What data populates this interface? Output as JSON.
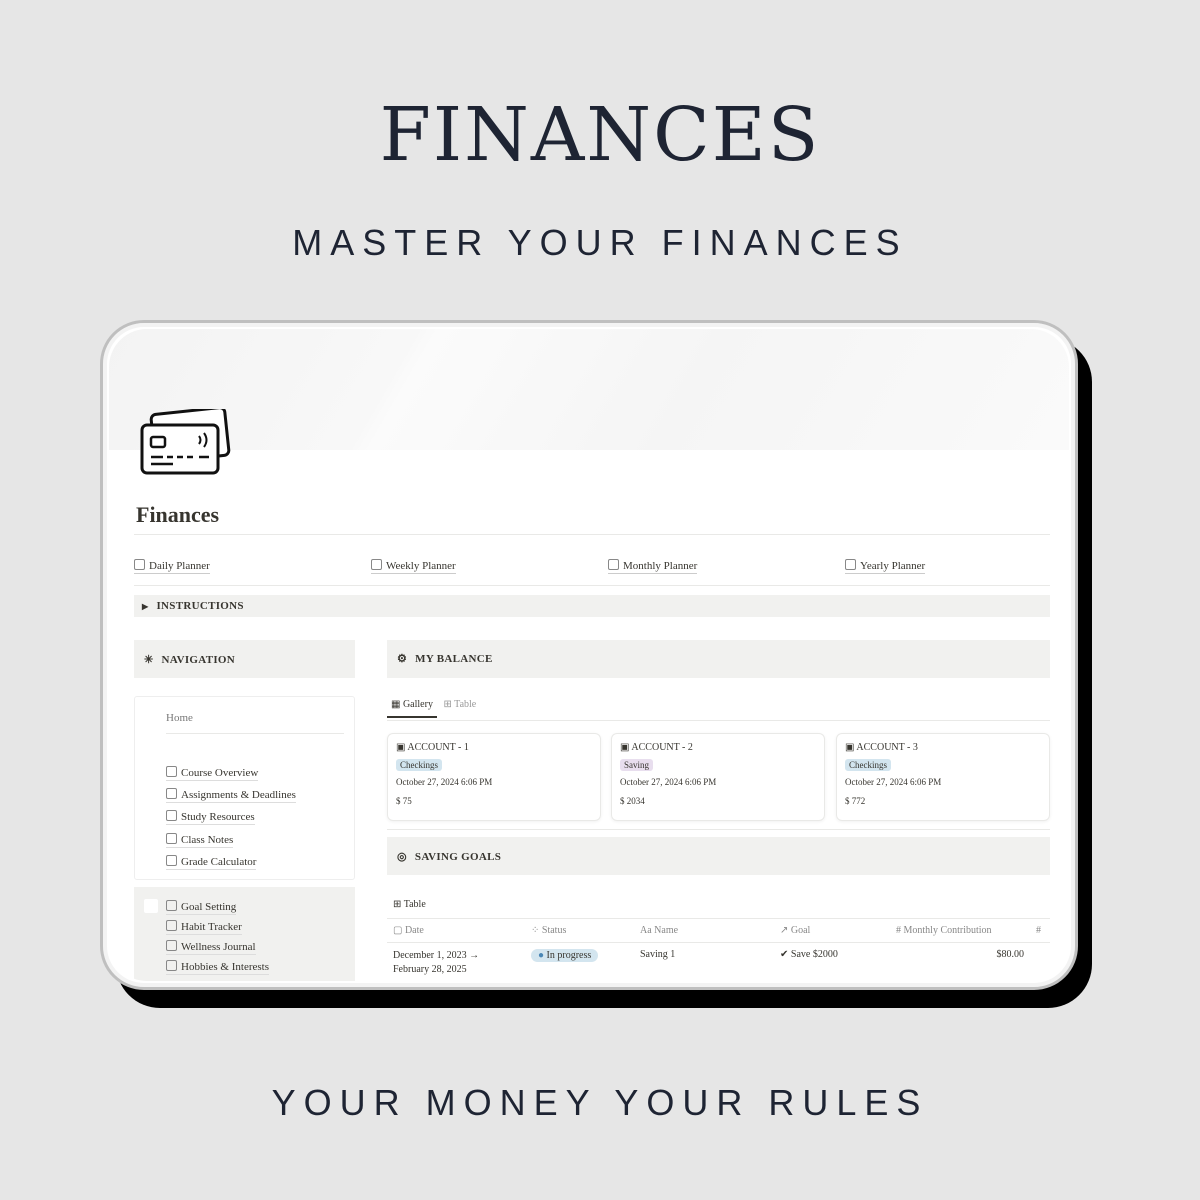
{
  "hero": {
    "title": "FINANCES",
    "subtitle": "MASTER YOUR FINANCES",
    "footer": "YOUR MONEY YOUR RULES"
  },
  "page": {
    "title": "Finances",
    "icon": "credit-card-icon",
    "links": [
      "Daily Planner",
      "Weekly Planner",
      "Monthly Planner",
      "Yearly Planner"
    ],
    "instructions": "INSTRUCTIONS",
    "navigation": {
      "heading": "NAVIGATION",
      "home": "Home",
      "items": [
        "Course Overview",
        "Assignments & Deadlines",
        "Study Resources",
        "Class Notes",
        "Grade Calculator"
      ],
      "items2": [
        "Goal Setting",
        "Habit Tracker",
        "Wellness Journal",
        "Hobbies & Interests"
      ]
    },
    "balance": {
      "heading": "MY BALANCE",
      "tabs": [
        "Gallery",
        "Table"
      ],
      "accounts": [
        {
          "name": "ACCOUNT - 1",
          "type": "Checkings",
          "date": "October 27, 2024 6:06 PM",
          "amount": "$ 75"
        },
        {
          "name": "ACCOUNT - 2",
          "type": "Saving",
          "date": "October 27, 2024 6:06 PM",
          "amount": "$ 2034"
        },
        {
          "name": "ACCOUNT - 3",
          "type": "Checkings",
          "date": "October 27, 2024 6:06 PM",
          "amount": "$ 772"
        }
      ]
    },
    "goals": {
      "heading": "SAVING GOALS",
      "view": "Table",
      "columns": [
        "Date",
        "Status",
        "Name",
        "Goal",
        "Monthly Contribution",
        "#"
      ],
      "rows": [
        {
          "date": "December 1, 2023 →",
          "date2": "February 28, 2025",
          "status": "In progress",
          "name": "Saving 1",
          "goal": "Save $2000",
          "contribution": "$80.00"
        }
      ]
    }
  },
  "colors": {
    "checkings": "#d3e5ef",
    "saving": "#e8deee",
    "in_progress": "#d3e5ef",
    "text": "#1e2433"
  }
}
